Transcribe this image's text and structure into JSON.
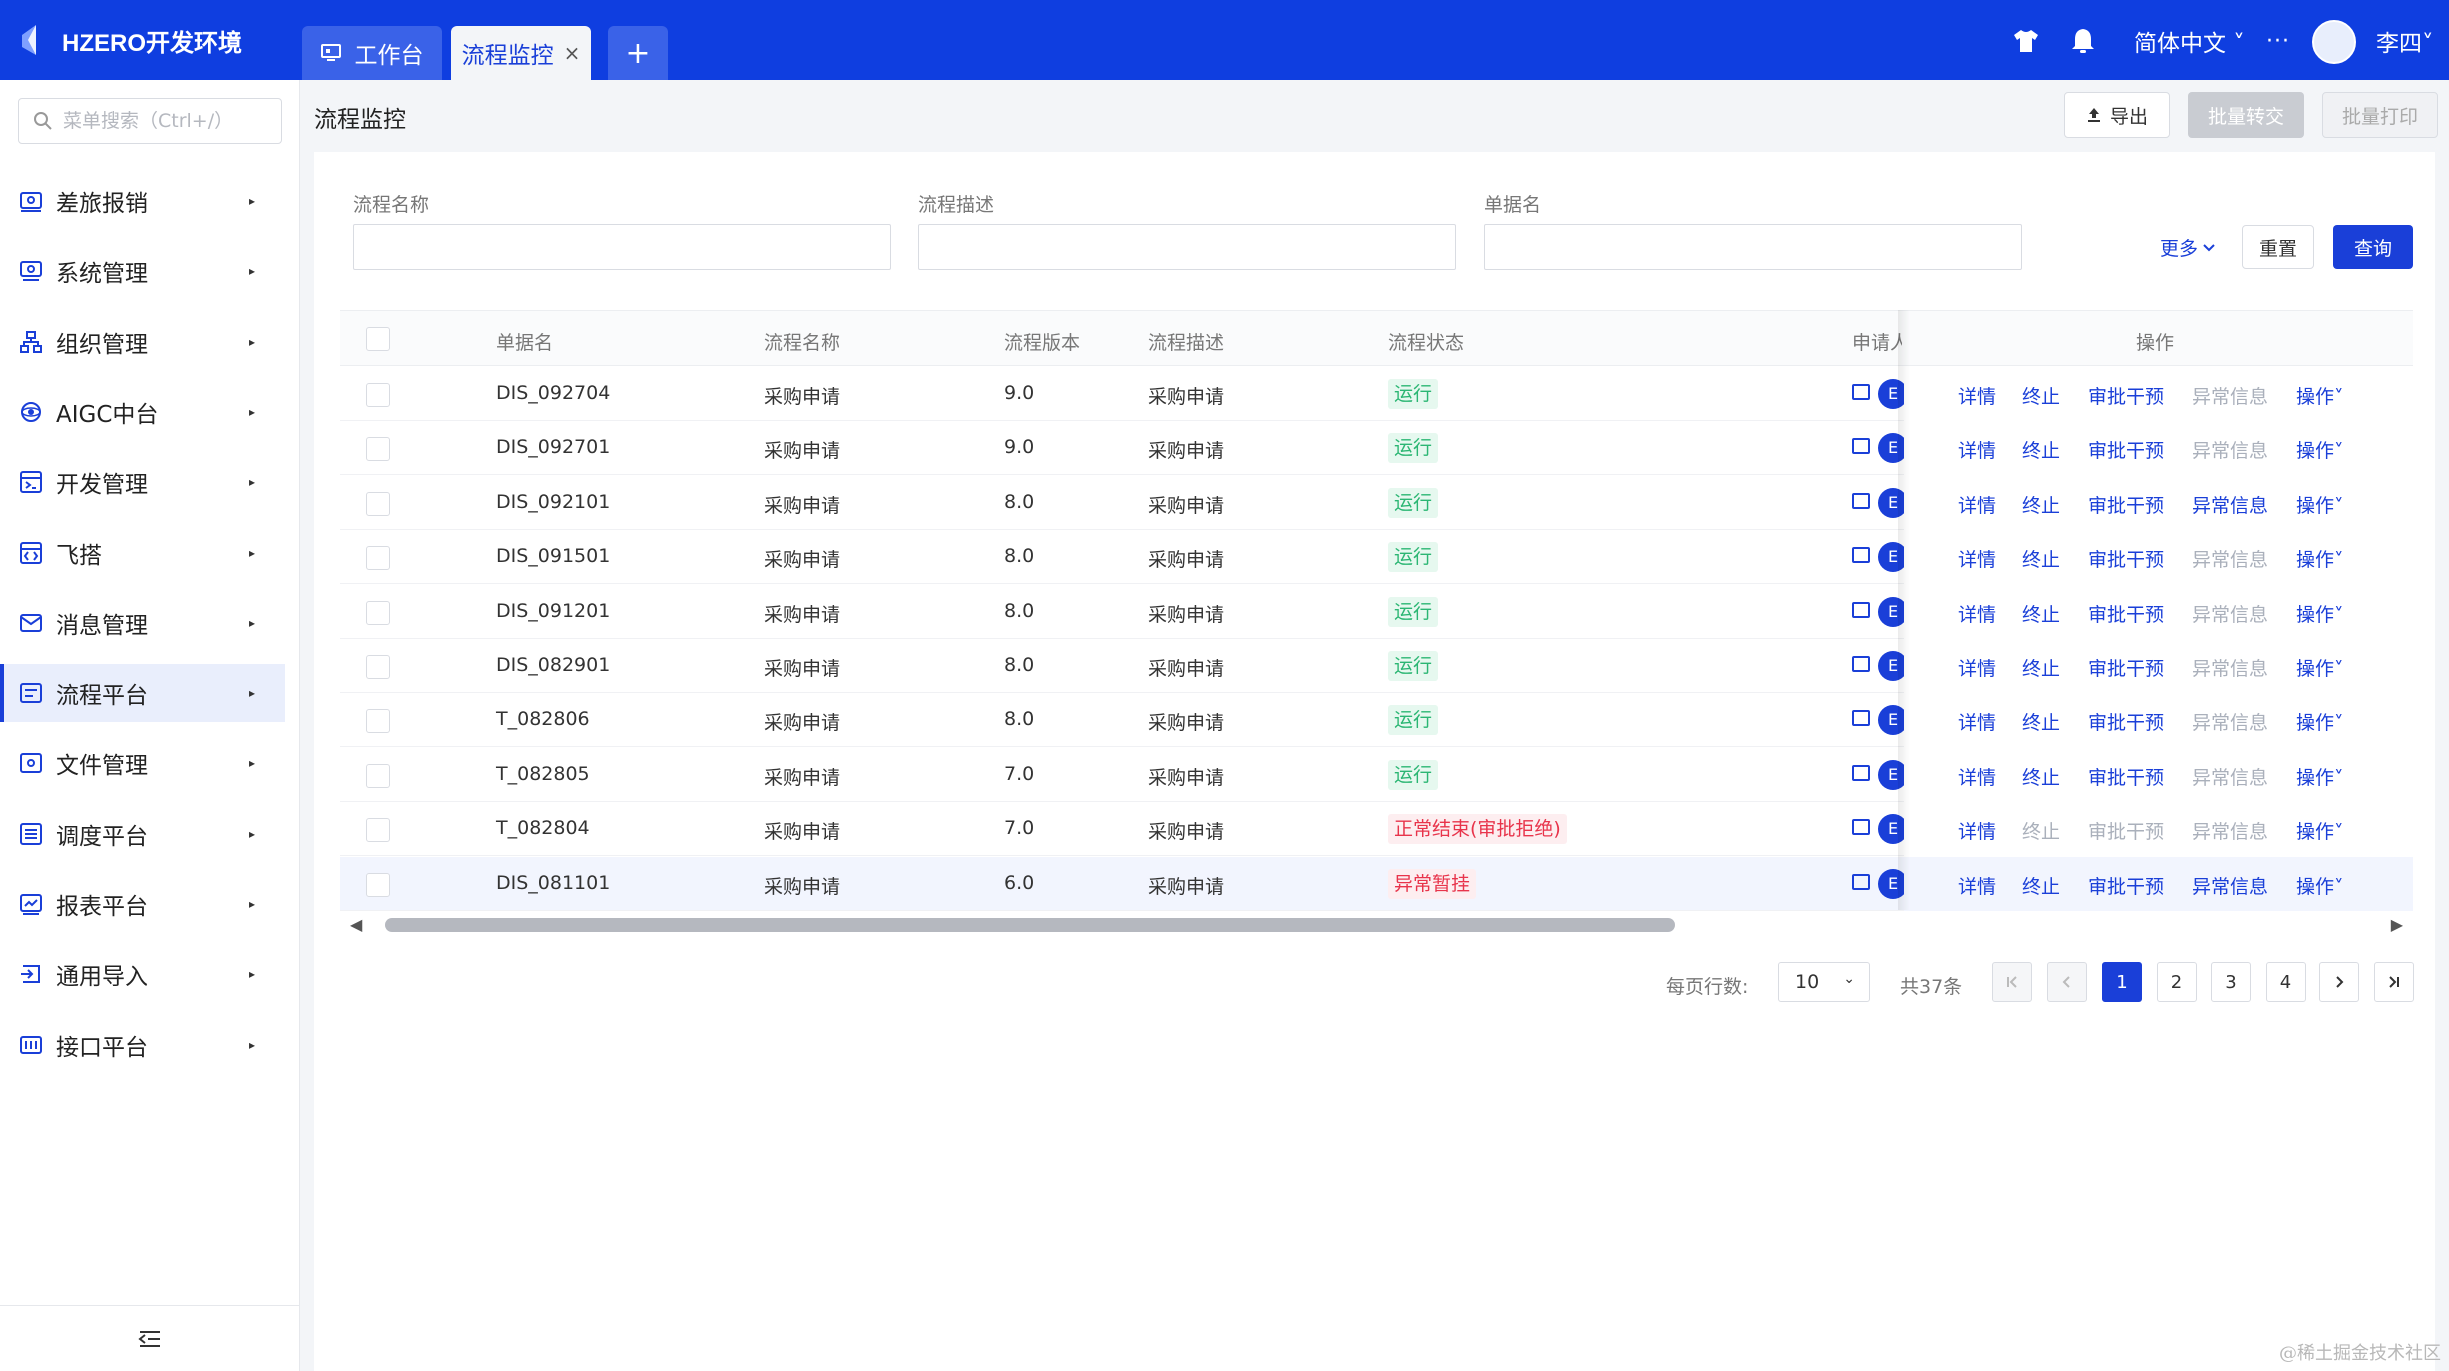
{
  "app": {
    "brand": "HZERO开发环境",
    "tabs": [
      {
        "label": "工作台"
      },
      {
        "label": "流程监控",
        "close": "×"
      }
    ],
    "add_tab": "+",
    "language": "简体中文 ˅",
    "more": "···",
    "user": "李四˅"
  },
  "sidebar": {
    "search_placeholder": "菜单搜索（Ctrl+/）",
    "items": [
      {
        "label": "差旅报销",
        "icon": "expense-icon"
      },
      {
        "label": "系统管理",
        "icon": "system-icon"
      },
      {
        "label": "组织管理",
        "icon": "org-icon"
      },
      {
        "label": "AIGC中台",
        "icon": "aigc-icon"
      },
      {
        "label": "开发管理",
        "icon": "dev-icon"
      },
      {
        "label": "飞搭",
        "icon": "code-icon"
      },
      {
        "label": "消息管理",
        "icon": "message-icon"
      },
      {
        "label": "流程平台",
        "icon": "workflow-icon",
        "active": true
      },
      {
        "label": "文件管理",
        "icon": "file-icon"
      },
      {
        "label": "调度平台",
        "icon": "schedule-icon"
      },
      {
        "label": "报表平台",
        "icon": "report-icon"
      },
      {
        "label": "通用导入",
        "icon": "import-icon"
      },
      {
        "label": "接口平台",
        "icon": "interface-icon"
      }
    ],
    "arrow": "▸"
  },
  "page": {
    "title": "流程监控",
    "export_label": "导出",
    "transfer_label": "批量转交",
    "print_label": "批量打印"
  },
  "filters": {
    "process_name_label": "流程名称",
    "process_desc_label": "流程描述",
    "document_label": "单据名",
    "more_label": "更多",
    "reset_label": "重置",
    "query_label": "查询"
  },
  "table": {
    "headers": {
      "document": "单据名",
      "process_name": "流程名称",
      "version": "流程版本",
      "desc": "流程描述",
      "status": "流程状态",
      "applicant": "申请人",
      "actions": "操作"
    },
    "rows": [
      {
        "document": "DIS_092704",
        "process_name": "采购申请",
        "version": "9.0",
        "desc": "采购申请",
        "status": "运行",
        "status_type": "run",
        "terminate_enabled": true,
        "intervene_enabled": true,
        "exception_enabled": false
      },
      {
        "document": "DIS_092701",
        "process_name": "采购申请",
        "version": "9.0",
        "desc": "采购申请",
        "status": "运行",
        "status_type": "run",
        "terminate_enabled": true,
        "intervene_enabled": true,
        "exception_enabled": false
      },
      {
        "document": "DIS_092101",
        "process_name": "采购申请",
        "version": "8.0",
        "desc": "采购申请",
        "status": "运行",
        "status_type": "run",
        "terminate_enabled": true,
        "intervene_enabled": true,
        "exception_enabled": true
      },
      {
        "document": "DIS_091501",
        "process_name": "采购申请",
        "version": "8.0",
        "desc": "采购申请",
        "status": "运行",
        "status_type": "run",
        "terminate_enabled": true,
        "intervene_enabled": true,
        "exception_enabled": false
      },
      {
        "document": "DIS_091201",
        "process_name": "采购申请",
        "version": "8.0",
        "desc": "采购申请",
        "status": "运行",
        "status_type": "run",
        "terminate_enabled": true,
        "intervene_enabled": true,
        "exception_enabled": false
      },
      {
        "document": "DIS_082901",
        "process_name": "采购申请",
        "version": "8.0",
        "desc": "采购申请",
        "status": "运行",
        "status_type": "run",
        "terminate_enabled": true,
        "intervene_enabled": true,
        "exception_enabled": false
      },
      {
        "document": "T_082806",
        "process_name": "采购申请",
        "version": "8.0",
        "desc": "采购申请",
        "status": "运行",
        "status_type": "run",
        "terminate_enabled": true,
        "intervene_enabled": true,
        "exception_enabled": false
      },
      {
        "document": "T_082805",
        "process_name": "采购申请",
        "version": "7.0",
        "desc": "采购申请",
        "status": "运行",
        "status_type": "run",
        "terminate_enabled": true,
        "intervene_enabled": true,
        "exception_enabled": false
      },
      {
        "document": "T_082804",
        "process_name": "采购申请",
        "version": "7.0",
        "desc": "采购申请",
        "status": "正常结束(审批拒绝)",
        "status_type": "err",
        "terminate_enabled": false,
        "intervene_enabled": false,
        "exception_enabled": false
      },
      {
        "document": "DIS_081101",
        "process_name": "采购申请",
        "version": "6.0",
        "desc": "采购申请",
        "status": "异常暂挂",
        "status_type": "err",
        "terminate_enabled": true,
        "intervene_enabled": true,
        "exception_enabled": true,
        "highlight": true
      }
    ],
    "applicant_initial": "E",
    "action_labels": {
      "detail": "详情",
      "terminate": "终止",
      "intervene": "审批干预",
      "exception": "异常信息",
      "more": "操作˅"
    }
  },
  "pagination": {
    "rows_per_page_label": "每页行数:",
    "page_size": "10",
    "total": "共37条",
    "pages": [
      "1",
      "2",
      "3",
      "4"
    ],
    "current_page": "1"
  },
  "watermark": "@稀土掘金技术社区",
  "colors": {
    "primary": "#1a3fd8",
    "topbar": "#0f3ee0",
    "status_run": "#2bb673",
    "status_err": "#e8344b"
  }
}
